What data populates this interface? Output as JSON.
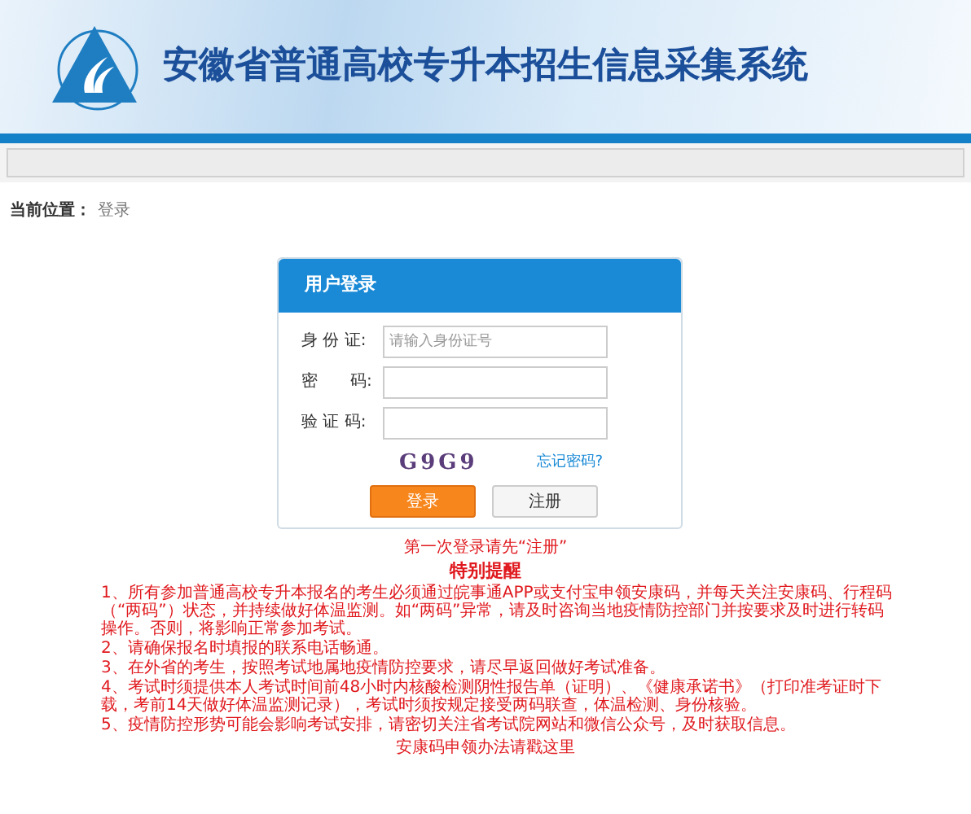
{
  "header": {
    "title": "安徽省普通高校专升本招生信息采集系统"
  },
  "breadcrumb": {
    "label": "当前位置：",
    "current": "登录"
  },
  "login": {
    "title": "用户登录",
    "fields": [
      {
        "label": "身 份 证:",
        "placeholder": "请输入身份证号"
      },
      {
        "label": "密　　码:"
      },
      {
        "label": "验 证 码:"
      }
    ],
    "captcha": "G9G9",
    "forgot": "忘记密码?",
    "buttons": [
      {
        "label": "登录",
        "kind": "primary"
      },
      {
        "label": "注册",
        "kind": "secondary"
      }
    ]
  },
  "first_login_hint": "第一次登录请先“注册”",
  "notice": {
    "title": "特别提醒",
    "items": [
      "1、所有参加普通高校专升本报名的考生必须通过皖事通APP或支付宝申领安康码，并每天关注安康码、行程码（“两码”）状态，并持续做好体温监测。如“两码”异常，请及时咨询当地疫情防控部门并按要求及时进行转码操作。否则，将影响正常参加考试。",
      "2、请确保报名时填报的联系电话畅通。",
      "3、在外省的考生，按照考试地属地疫情防控要求，请尽早返回做好考试准备。",
      "4、考试时须提供本人考试时间前48小时内核酸检测阴性报告单（证明）、《健康承诺书》（打印准考证时下载，考前14天做好体温监测记录），考试时须按规定接受两码联查，体温检测、身份核验。",
      "5、疫情防控形势可能会影响考试安排，请密切关注省考试院网站和微信公众号，及时获取信息。"
    ]
  },
  "footer_link": "安康码申领办法请戳这里"
}
